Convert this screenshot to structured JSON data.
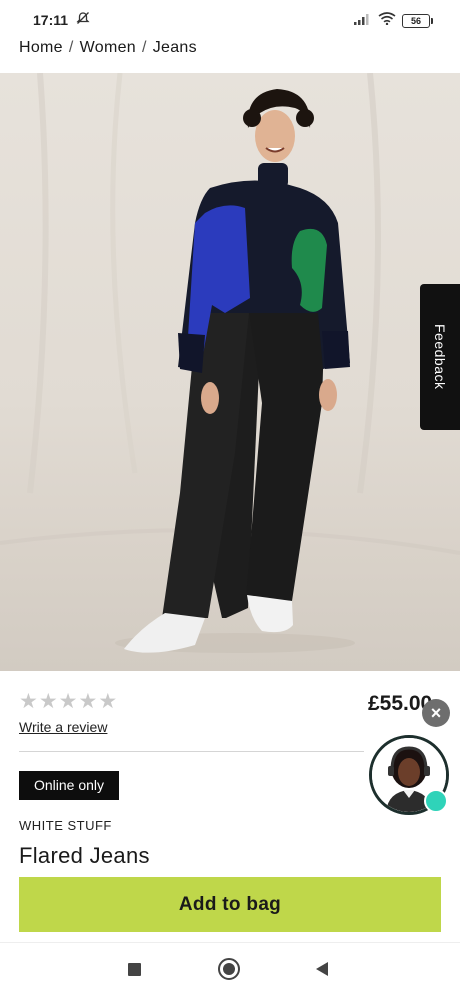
{
  "status_bar": {
    "time": "17:11",
    "battery": "56"
  },
  "breadcrumb": {
    "items": [
      "Home",
      "Women",
      "Jeans"
    ],
    "separator": "/"
  },
  "hero": {
    "image_count": 6,
    "active_index": 0
  },
  "feedback": {
    "label": "Feedback"
  },
  "product": {
    "rating_stars": 0,
    "rating_max": 5,
    "review_link": "Write a review",
    "price": "£55.00",
    "badge": "Online only",
    "brand": "WHITE STUFF",
    "name": "Flared Jeans"
  },
  "chat": {
    "close_label": "×",
    "status_color": "#2fd3b9"
  },
  "cta": {
    "add_to_bag": "Add to bag",
    "color": "#bfd74a"
  }
}
